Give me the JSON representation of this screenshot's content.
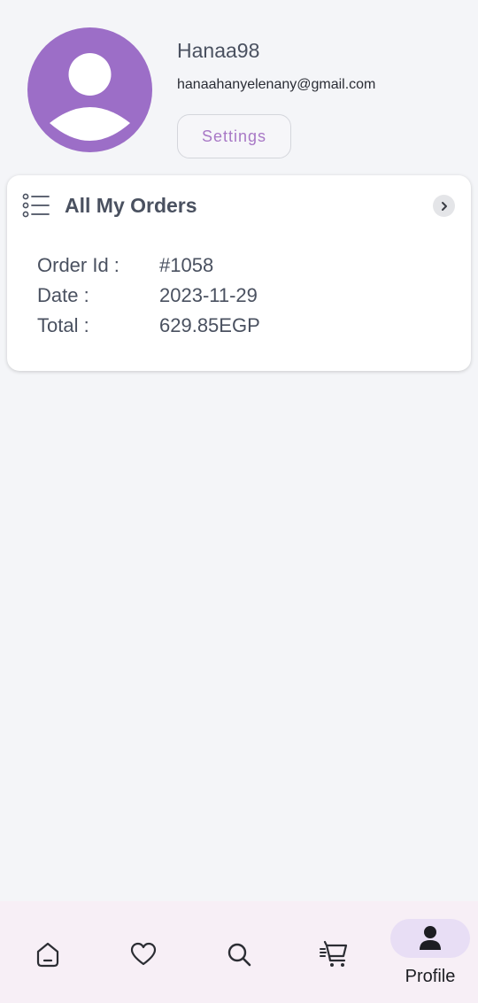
{
  "profile": {
    "username": "Hanaa98",
    "email": "hanaahanyelenany@gmail.com",
    "settings_label": "Settings",
    "avatar_color": "#9c6ec7"
  },
  "orders": {
    "title": "All My Orders",
    "list_icon": "list-icon",
    "chevron_icon": "chevron-right-icon",
    "rows": [
      {
        "label": "Order Id :",
        "value": "#1058"
      },
      {
        "label": "Date :",
        "value": "2023-11-29"
      },
      {
        "label": "Total :",
        "value": "629.85EGP"
      }
    ]
  },
  "nav": {
    "items": [
      {
        "icon": "home-icon"
      },
      {
        "icon": "heart-icon"
      },
      {
        "icon": "search-icon"
      },
      {
        "icon": "cart-icon"
      },
      {
        "icon": "person-icon",
        "label": "Profile",
        "active": true
      }
    ],
    "active_pill_color": "#e8def5",
    "background": "#f7eff6"
  }
}
